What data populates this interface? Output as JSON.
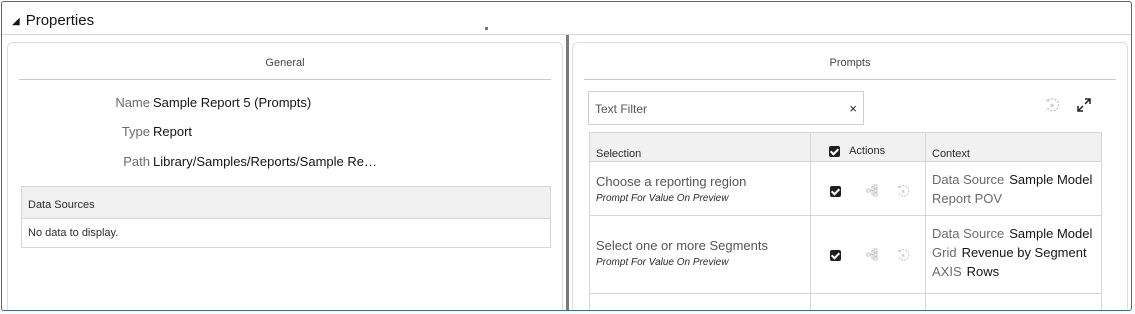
{
  "header": {
    "title": "Properties"
  },
  "general": {
    "title": "General",
    "properties": [
      {
        "label": "Name",
        "value": "Sample Report 5 (Prompts)"
      },
      {
        "label": "Type",
        "value": "Report"
      },
      {
        "label": "Path",
        "value": "Library/Samples/Reports/Sample Re…"
      }
    ],
    "data_sources": {
      "header": "Data Sources",
      "empty_text": "No data to display."
    }
  },
  "prompts": {
    "title": "Prompts",
    "filter_placeholder": "Text Filter",
    "filter_clear": "×",
    "columns": {
      "selection": "Selection",
      "actions": "Actions",
      "context": "Context"
    },
    "rows": [
      {
        "title": "Choose a reporting region",
        "subtitle": "Prompt For Value On Preview",
        "context": [
          {
            "key": "Data Source",
            "value": "Sample Model"
          },
          {
            "key": "Report POV",
            "value": ""
          }
        ]
      },
      {
        "title": "Select one or more Segments",
        "subtitle": "Prompt For Value On Preview",
        "context": [
          {
            "key": "Data Source",
            "value": "Sample Model"
          },
          {
            "key": "Grid",
            "value": "Revenue by Segment"
          },
          {
            "key": "AXIS",
            "value": "Rows"
          }
        ]
      }
    ]
  },
  "icons": {
    "collapse": "triangle-collapse-icon",
    "reset": "reset-icon",
    "expand": "expand-icon",
    "hierarchy": "member-selector-icon",
    "row_reset": "row-reset-icon"
  }
}
